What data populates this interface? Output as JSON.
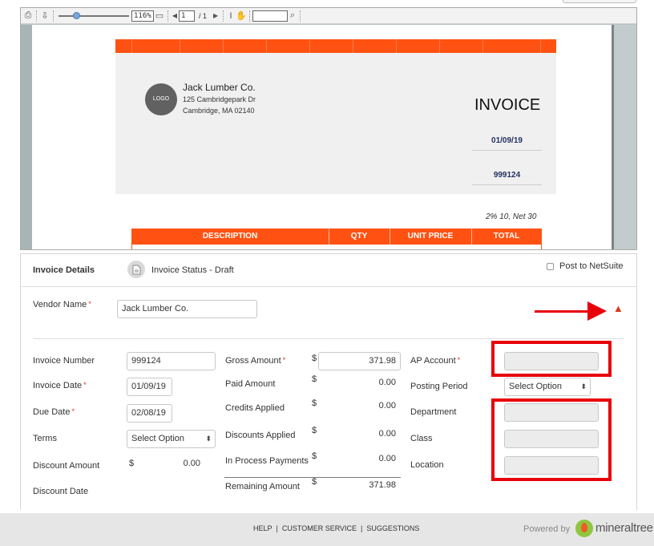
{
  "viewer": {
    "zoom": "116%",
    "page_input": "1",
    "page_total": "/ 1",
    "find_value": ""
  },
  "invoice_doc": {
    "logo_text": "LOGO",
    "company": "Jack Lumber Co.",
    "address_line1": "125 Cambridgepark Dr",
    "address_line2": "Cambridge, MA 02140",
    "title": "INVOICE",
    "date": "01/09/19",
    "number": "999124",
    "terms": "2% 10, Net 30",
    "columns": [
      "DESCRIPTION",
      "QTY",
      "UNIT PRICE",
      "TOTAL"
    ],
    "accent_color": "#ff5212"
  },
  "details": {
    "title": "Invoice Details",
    "status": "Invoice Status - Draft",
    "post_label": "Post to NetSuite",
    "vendor_label": "Vendor Name",
    "vendor_value": "Jack Lumber Co.",
    "invoice_number_label": "Invoice Number",
    "invoice_number_value": "999124",
    "invoice_date_label": "Invoice Date",
    "invoice_date_value": "01/09/19",
    "due_date_label": "Due Date",
    "due_date_value": "02/08/19",
    "terms_label": "Terms",
    "terms_value": "Select Option",
    "discount_amount_label": "Discount Amount",
    "discount_amount_currency": "$",
    "discount_amount_value": "0.00",
    "discount_date_label": "Discount Date",
    "gross_amount_label": "Gross Amount",
    "gross_amount_value": "371.98",
    "paid_amount_label": "Paid Amount",
    "paid_amount_value": "0.00",
    "credits_applied_label": "Credits Applied",
    "credits_applied_value": "0.00",
    "discounts_applied_label": "Discounts Applied",
    "discounts_applied_value": "0.00",
    "in_process_label": "In Process Payments",
    "in_process_value": "0.00",
    "remaining_label": "Remaining Amount",
    "remaining_value": "371.98",
    "currency": "$",
    "ap_account_label": "AP Account",
    "posting_period_label": "Posting Period",
    "posting_period_value": "Select Option",
    "department_label": "Department",
    "class_label": "Class",
    "location_label": "Location",
    "required_mark": "*",
    "highlight_color": "#e8000a"
  },
  "footer": {
    "help": "HELP",
    "customer_service": "CUSTOMER SERVICE",
    "suggestions": "SUGGESTIONS",
    "separator": "|",
    "powered_by": "Powered by",
    "brand": "mineraltree"
  }
}
